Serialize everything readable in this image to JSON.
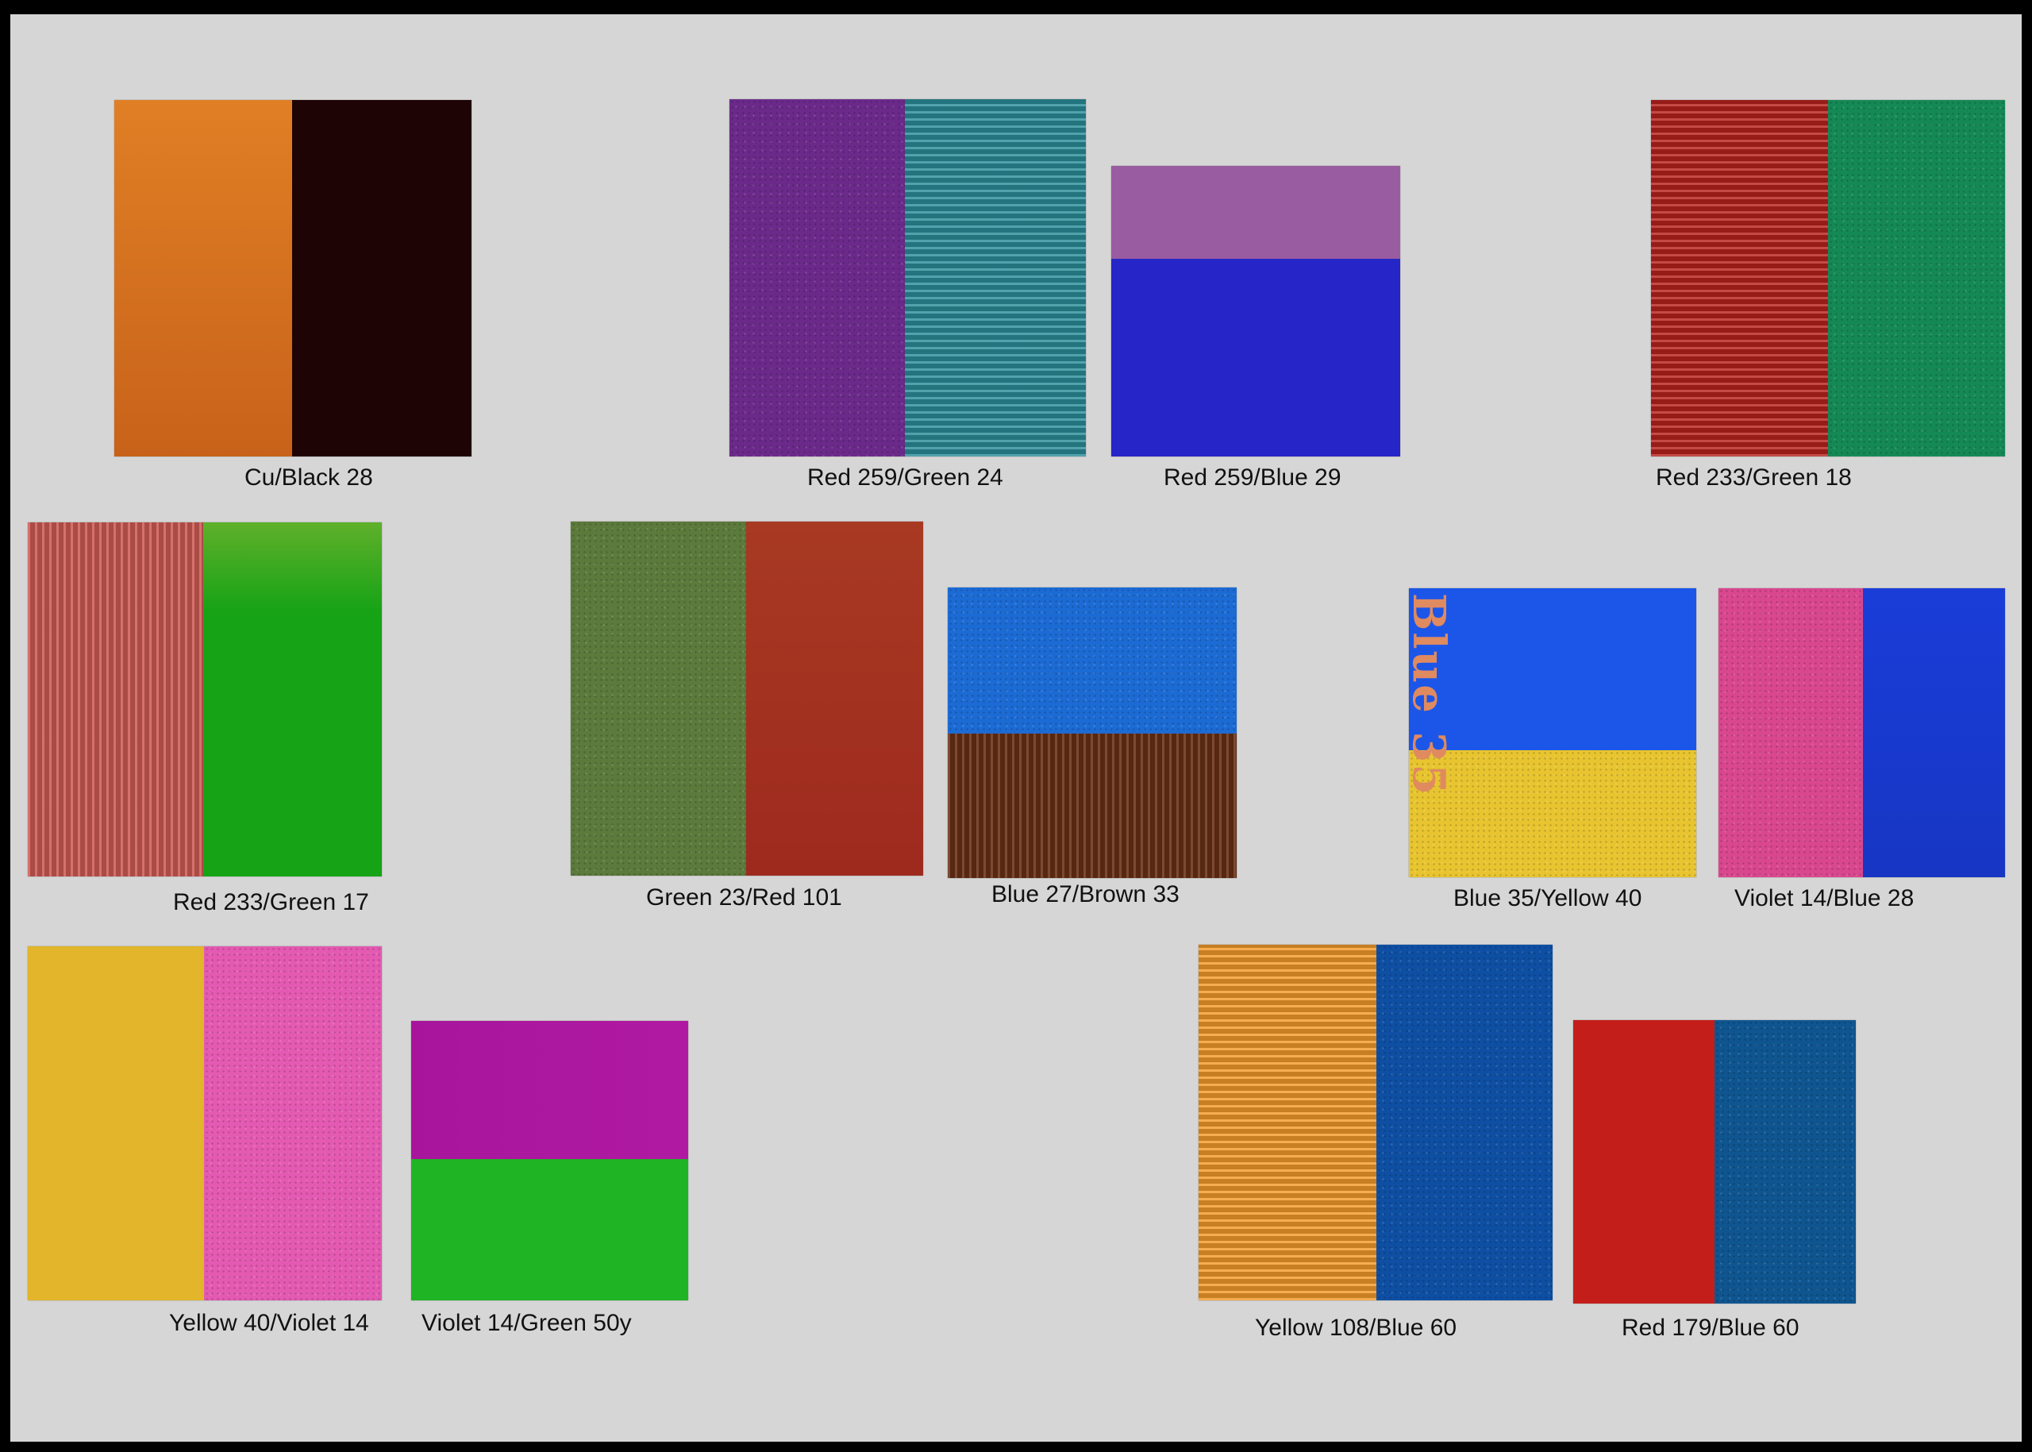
{
  "artworks": [
    {
      "id": "cu-black-28",
      "caption": "Cu/Black 28",
      "colors": [
        "#d9721c",
        "#1f0405"
      ]
    },
    {
      "id": "red259-green24",
      "caption": "Red 259/Green 24",
      "colors": [
        "#6b2a8a",
        "#2b8d99"
      ]
    },
    {
      "id": "red259-blue29",
      "caption": "Red 259/Blue 29",
      "colors": [
        "#9a5ca0",
        "#2525c8"
      ]
    },
    {
      "id": "red233-green18",
      "caption": "Red 233/Green 18",
      "colors": [
        "#b8221c",
        "#158955"
      ]
    },
    {
      "id": "red233-green17",
      "caption": "Red 233/Green 17",
      "colors": [
        "#cf5d55",
        "#17a316"
      ]
    },
    {
      "id": "green23-red101",
      "caption": "Green 23/Red 101",
      "colors": [
        "#5c7a3c",
        "#a33121"
      ]
    },
    {
      "id": "blue27-brown33",
      "caption": "Blue 27/Brown 33",
      "colors": [
        "#1c6bd4",
        "#6a3115"
      ]
    },
    {
      "id": "blue35-yellow40",
      "caption": "Blue 35/Yellow 40",
      "colors": [
        "#1c56e8",
        "#e8c530"
      ],
      "stencil": "Blue 35"
    },
    {
      "id": "violet14-blue28",
      "caption": "Violet 14/Blue 28",
      "colors": [
        "#d9478f",
        "#1a3dd8"
      ]
    },
    {
      "id": "yellow40-violet14",
      "caption": "Yellow 40/Violet 14",
      "colors": [
        "#e2b52a",
        "#e45ab2"
      ]
    },
    {
      "id": "violet14-green50y",
      "caption": "Violet 14/Green 50y",
      "colors": [
        "#a8159c",
        "#1eb424"
      ]
    },
    {
      "id": "yellow108-blue60",
      "caption": "Yellow 108/Blue 60",
      "colors": [
        "#f49a2a",
        "#0e4fa3"
      ]
    },
    {
      "id": "red179-blue60",
      "caption": "Red 179/Blue 60",
      "colors": [
        "#c41e1a",
        "#0f5590"
      ]
    }
  ]
}
